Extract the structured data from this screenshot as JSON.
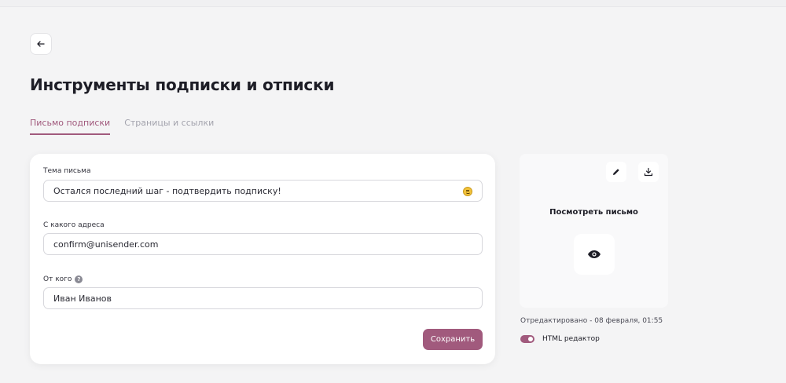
{
  "page": {
    "title": "Инструменты подписки и отписки"
  },
  "tabs": [
    {
      "label": "Письмо подписки",
      "active": true
    },
    {
      "label": "Страницы и ссылки",
      "active": false
    }
  ],
  "form": {
    "subject": {
      "label": "Тема письма",
      "value": "Остался последний шаг - подтвердить подписку!"
    },
    "from_address": {
      "label": "С какого адреса",
      "value": "confirm@unisender.com"
    },
    "from_name": {
      "label": "От кого",
      "value": "Иван Иванов",
      "help": "?"
    },
    "save_label": "Сохранить"
  },
  "preview": {
    "title": "Посмотреть письмо",
    "edited": "Отредактировано - 08 февраля, 01:55",
    "html_editor_label": "HTML редактор",
    "html_editor_on": true
  },
  "icons": {
    "back": "arrow-left-icon",
    "edit": "pencil-icon",
    "download": "download-icon",
    "view": "eye-icon",
    "emoji": "emoji-icon",
    "help": "question-icon"
  },
  "colors": {
    "accent": "#a15a7d",
    "background": "#f4f4f5"
  }
}
